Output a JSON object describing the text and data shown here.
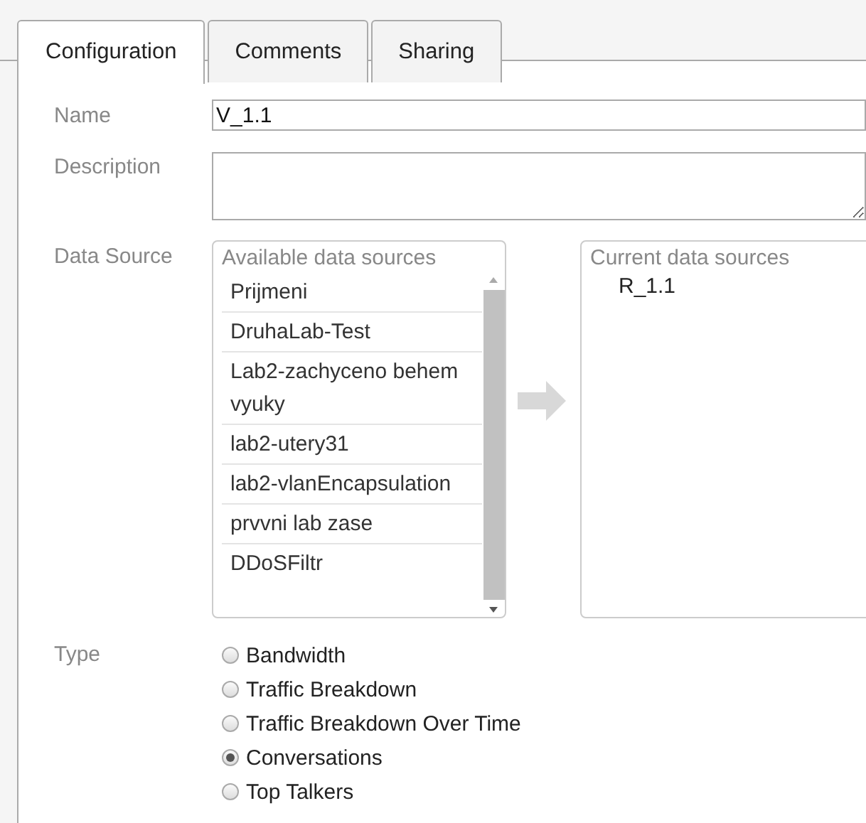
{
  "tabs": [
    {
      "label": "Configuration",
      "selected": true
    },
    {
      "label": "Comments",
      "selected": false
    },
    {
      "label": "Sharing",
      "selected": false
    }
  ],
  "name": {
    "label": "Name",
    "value": "V_1.1"
  },
  "description": {
    "label": "Description"
  },
  "data_source": {
    "label": "Data Source",
    "available_title": "Available data sources",
    "available": [
      "Prijmeni",
      "DruhaLab-Test",
      "Lab2-zachyceno behem vyuky",
      "lab2-utery31",
      "lab2-vlanEncapsulation",
      "prvvni lab zase",
      "DDoSFiltr"
    ],
    "current_title": "Current data sources",
    "current": [
      "R_1.1"
    ]
  },
  "type": {
    "label": "Type",
    "options": [
      {
        "label": "Bandwidth",
        "selected": false
      },
      {
        "label": "Traffic Breakdown",
        "selected": false
      },
      {
        "label": "Traffic Breakdown Over Time",
        "selected": false
      },
      {
        "label": "Conversations",
        "selected": true
      },
      {
        "label": "Top Talkers",
        "selected": false
      }
    ]
  }
}
